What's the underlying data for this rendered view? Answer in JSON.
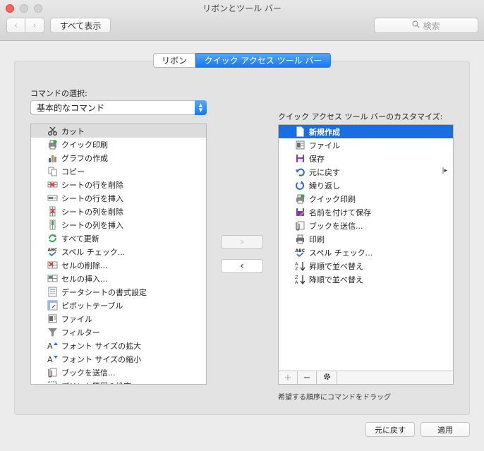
{
  "window": {
    "title": "リボンとツール バー"
  },
  "toolbar": {
    "show_all_label": "すべて表示",
    "search_placeholder": "検索"
  },
  "tabs": [
    {
      "label": "リボン",
      "selected": false
    },
    {
      "label": "クイック アクセス ツール バー",
      "selected": true
    }
  ],
  "commands": {
    "chooser_label": "コマンドの選択:",
    "chooser_value": "基本的なコマンド",
    "items": [
      {
        "label": "カット",
        "icon": "scissors-icon"
      },
      {
        "label": "クイック印刷",
        "icon": "quick-print-icon"
      },
      {
        "label": "グラフの作成",
        "icon": "chart-icon"
      },
      {
        "label": "コピー",
        "icon": "copy-icon"
      },
      {
        "label": "シートの行を削除",
        "icon": "delete-row-icon"
      },
      {
        "label": "シートの行を挿入",
        "icon": "insert-row-icon"
      },
      {
        "label": "シートの列を削除",
        "icon": "delete-column-icon"
      },
      {
        "label": "シートの列を挿入",
        "icon": "insert-column-icon"
      },
      {
        "label": "すべて更新",
        "icon": "refresh-all-icon"
      },
      {
        "label": "スペル チェック...",
        "icon": "spellcheck-icon"
      },
      {
        "label": "セルの削除...",
        "icon": "delete-cells-icon"
      },
      {
        "label": "セルの挿入...",
        "icon": "insert-cells-icon"
      },
      {
        "label": "データシートの書式設定",
        "icon": "datasheet-format-icon"
      },
      {
        "label": "ピボットテーブル",
        "icon": "pivot-table-icon"
      },
      {
        "label": "ファイル",
        "icon": "file-icon"
      },
      {
        "label": "フィルター",
        "icon": "filter-icon"
      },
      {
        "label": "フォント サイズの拡大",
        "icon": "font-grow-icon"
      },
      {
        "label": "フォント サイズの縮小",
        "icon": "font-shrink-icon"
      },
      {
        "label": "ブックを送信...",
        "icon": "send-workbook-icon"
      },
      {
        "label": "プリント範囲の設定",
        "icon": "print-area-icon"
      }
    ]
  },
  "qat": {
    "label": "クイック アクセス ツール バーのカスタマイズ:",
    "items": [
      {
        "label": "新規作成",
        "icon": "new-document-icon"
      },
      {
        "label": "ファイル",
        "icon": "file-icon"
      },
      {
        "label": "保存",
        "icon": "save-icon"
      },
      {
        "label": "元に戻す",
        "icon": "undo-icon"
      },
      {
        "label": "繰り返し",
        "icon": "redo-icon"
      },
      {
        "label": "クイック印刷",
        "icon": "quick-print-icon"
      },
      {
        "label": "名前を付けて保存",
        "icon": "save-as-icon"
      },
      {
        "label": "ブックを送信...",
        "icon": "send-workbook-icon"
      },
      {
        "label": "印刷",
        "icon": "print-icon"
      },
      {
        "label": "スペル チェック...",
        "icon": "spellcheck-icon"
      },
      {
        "label": "昇順で並べ替え",
        "icon": "sort-ascending-icon"
      },
      {
        "label": "降順で並べ替え",
        "icon": "sort-descending-icon"
      }
    ],
    "hint": "希望する順序にコマンドをドラッグ"
  },
  "buttons": {
    "add_glyph": "›",
    "remove_glyph": "‹",
    "plus_glyph": "+",
    "minus_glyph": "−",
    "reset_label": "元に戻す",
    "apply_label": "適用"
  },
  "colors": {
    "accent": "#1a78ec",
    "selection": "#1a6fe0",
    "close": "#fc5f57"
  }
}
